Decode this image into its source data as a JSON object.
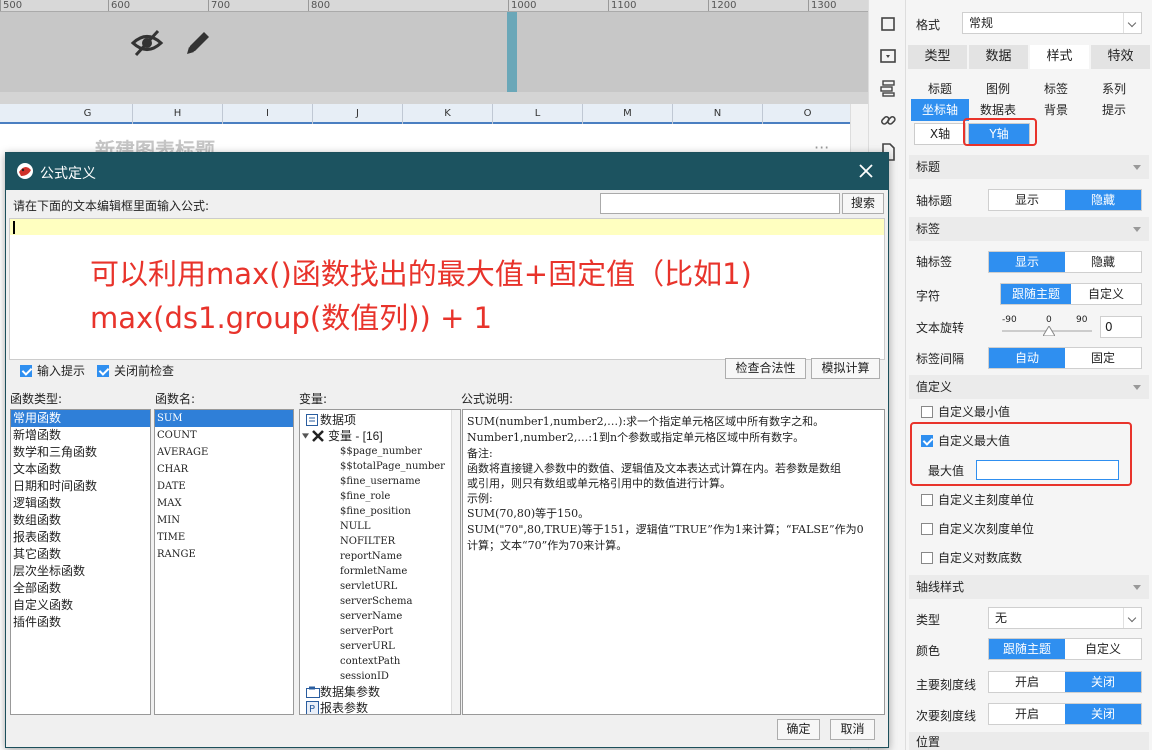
{
  "ruler": [
    "500",
    "600",
    "700",
    "800",
    "1000",
    "1100",
    "1200",
    "1300"
  ],
  "columns": [
    "G",
    "H",
    "I",
    "J",
    "K",
    "L",
    "M",
    "N",
    "O"
  ],
  "bg_title": "新建图表标题",
  "bg_more": "···",
  "panel": {
    "format_label": "格式",
    "format_value": "常规",
    "main_tabs": [
      "类型",
      "数据",
      "样式",
      "特效"
    ],
    "style_tabs_row1": [
      "标题",
      "图例",
      "标签",
      "系列"
    ],
    "style_tabs_row2": [
      "坐标轴",
      "数据表",
      "背景",
      "提示"
    ],
    "axis_tabs": [
      "X轴",
      "Y轴"
    ],
    "sec_title": "标题",
    "axis_title_label": "轴标题",
    "show": "显示",
    "hide": "隐藏",
    "sec_label": "标签",
    "axis_label_label": "轴标签",
    "char_label": "字符",
    "follow_theme": "跟随主题",
    "custom": "自定义",
    "rotate_label": "文本旋转",
    "rotate_min": "-90",
    "rotate_mid": "0",
    "rotate_max": "90",
    "rotate_value": "0",
    "interval_label": "标签间隔",
    "auto": "自动",
    "fixed": "固定",
    "sec_value": "值定义",
    "custom_min": "自定义最小值",
    "custom_max": "自定义最大值",
    "max_label": "最大值",
    "max_value": "",
    "custom_major": "自定义主刻度单位",
    "custom_minor": "自定义次刻度单位",
    "custom_log": "自定义对数底数",
    "sec_line": "轴线样式",
    "type_label": "类型",
    "type_value": "无",
    "color_label": "颜色",
    "major_tick_label": "主要刻度线",
    "minor_tick_label": "次要刻度线",
    "on": "开启",
    "off": "关闭",
    "sec_position": "位置"
  },
  "dialog": {
    "title": "公式定义",
    "prompt": "请在下面的文本编辑框里面输入公式:",
    "search_placeholder": "",
    "search_button": "搜索",
    "annotation_line1": "可以利用max()函数找出的最大值+固定值（比如1)",
    "annotation_line2": "max(ds1.group(数值列)) + 1",
    "input_hint": "输入提示",
    "check_before_close": "关闭前检查",
    "check_validity": "检查合法性",
    "simulate": "模拟计算",
    "func_type_label": "函数类型:",
    "func_name_label": "函数名:",
    "var_label": "变量:",
    "desc_label": "公式说明:",
    "func_types": [
      "常用函数",
      "新增函数",
      "数学和三角函数",
      "文本函数",
      "日期和时间函数",
      "逻辑函数",
      "数组函数",
      "报表函数",
      "其它函数",
      "层次坐标函数",
      "全部函数",
      "自定义函数",
      "插件函数"
    ],
    "func_names": [
      "SUM",
      "COUNT",
      "AVERAGE",
      "CHAR",
      "DATE",
      "MAX",
      "MIN",
      "TIME",
      "RANGE"
    ],
    "var_data_item": "数据项",
    "var_variable": "变量 - [16]",
    "variables": [
      "$$page_number",
      "$$totalPage_number",
      "$fine_username",
      "$fine_role",
      "$fine_position",
      "NULL",
      "NOFILTER",
      "reportName",
      "formletName",
      "servletURL",
      "serverSchema",
      "serverName",
      "serverPort",
      "serverURL",
      "contextPath",
      "sessionID"
    ],
    "var_dataset_param": "数据集参数",
    "var_report_param": "报表参数",
    "description": [
      "SUM(number1,number2,…):求一个指定单元格区域中所有数字之和。",
      "Number1,number2,…:1到n个参数或指定单元格区域中所有数字。",
      "备注:",
      "函数将直接键入参数中的数值、逻辑值及文本表达式计算在内。若参数是数组",
      "或引用，则只有数组或单元格引用中的数值进行计算。",
      "示例:",
      "SUM(70,80)等于150。",
      "SUM(\"70\",80,TRUE)等于151，逻辑值“TRUE”作为1来计算；“FALSE”作为0",
      "计算；文本“70”作为70来计算。"
    ],
    "ok": "确定",
    "cancel": "取消"
  }
}
